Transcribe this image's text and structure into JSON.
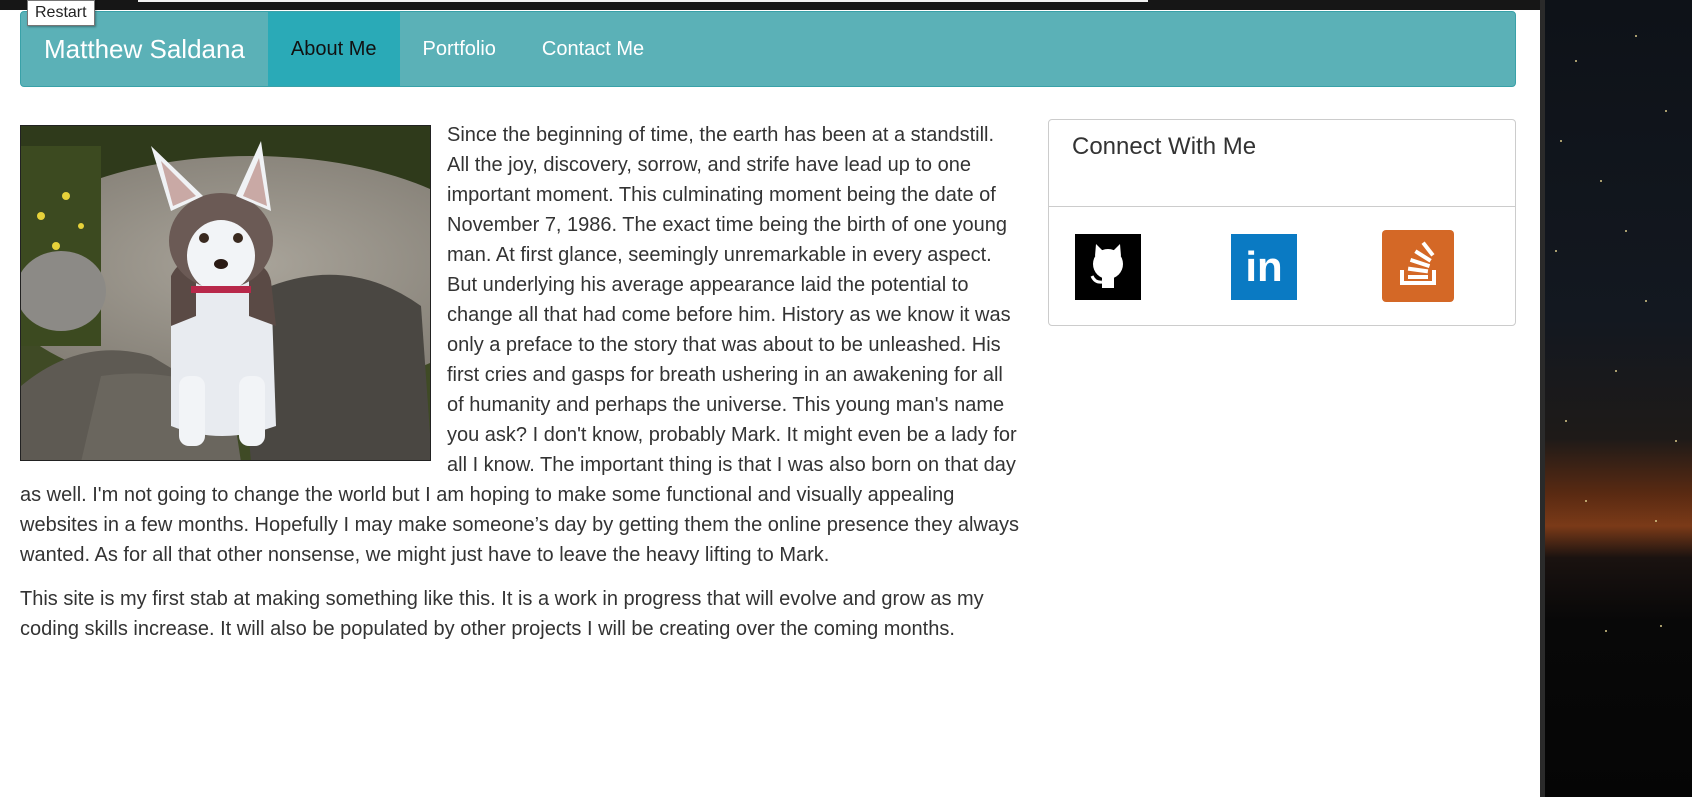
{
  "tooltip": {
    "text": "Restart"
  },
  "navbar": {
    "brand": "Matthew Saldana",
    "items": [
      {
        "label": "About Me",
        "active": true
      },
      {
        "label": "Portfolio",
        "active": false
      },
      {
        "label": "Contact Me",
        "active": false
      }
    ]
  },
  "main": {
    "paragraph1": "Since the beginning of time, the earth has been at a standstill. All the joy, discovery, sorrow, and strife have lead up to one important moment. This culminating moment being the date of November 7, 1986. The exact time being the birth of one young man. At first glance, seemingly unremarkable in every aspect. But underlying his average appearance laid the potential to change all that had come before him. History as we know it was only a preface to the story that was about to be unleashed. His first cries and gasps for breath ushering in an awakening for all of humanity and perhaps the universe. This young man's name you ask? I don't know, probably Mark. It might even be a lady for all I know. The important thing is that I was also born on that day as well. I'm not going to change the world but I am hoping to make some functional and visually appealing websites in a few months. Hopefully I may make someone’s day by getting them the online presence they always wanted. As for all that other nonsense, we might just have to leave the heavy lifting to Mark.",
    "paragraph2": "This site is my first stab at making something like this. It is a work in progress that will evolve and grow as my coding skills increase. It will also be populated by other projects I will be creating over the coming months."
  },
  "panel": {
    "heading": "Connect With Me",
    "links": [
      {
        "icon": "github-icon",
        "color": "#000000"
      },
      {
        "icon": "linkedin-icon",
        "text": "in",
        "color": "#0a7ac3"
      },
      {
        "icon": "stackoverflow-icon",
        "color": "#d46826"
      }
    ]
  },
  "colors": {
    "navbar": "#5bb1b7",
    "nav_active": "#2aaab7"
  }
}
